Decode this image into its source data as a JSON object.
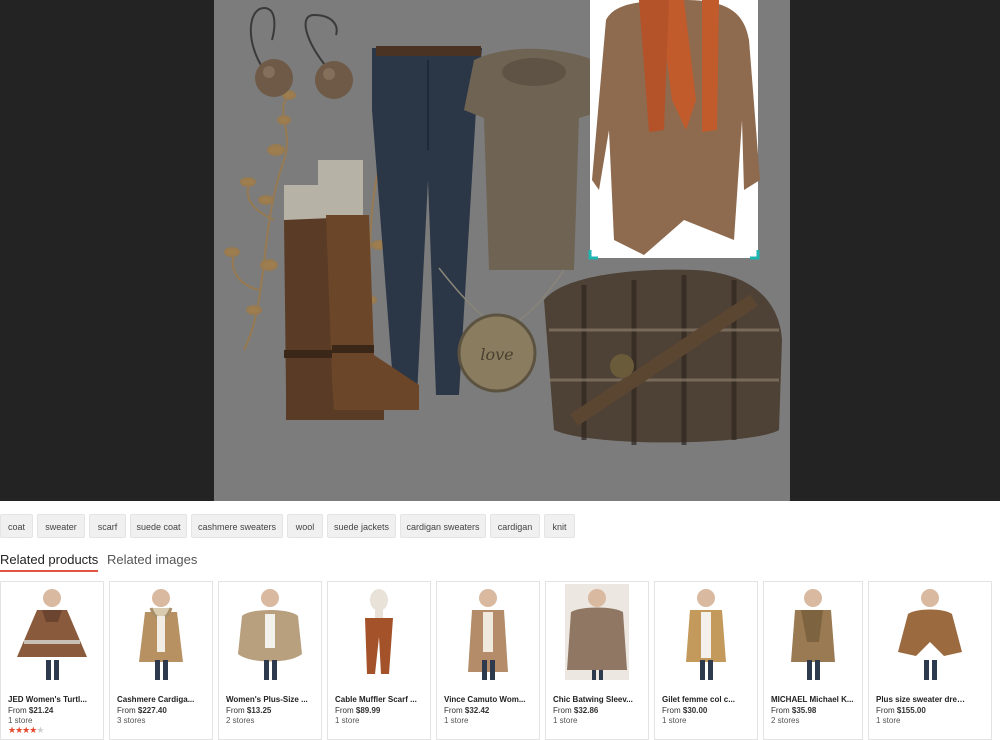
{
  "colors": {
    "viewer_bg": "#232323",
    "image_overlay": "#7c7c7c",
    "selection_bracket": "#1fb5b0",
    "active_tab_underline": "#e25440",
    "star": "#e64a2e"
  },
  "main_image": {
    "items": [
      "earrings",
      "boots",
      "jeans",
      "top",
      "cardigan-with-scarf",
      "necklace",
      "plaid-bag"
    ],
    "necklace_text": "love",
    "selected_item": "cardigan-with-scarf"
  },
  "tags": [
    "coat",
    "sweater",
    "scarf",
    "suede coat",
    "cashmere sweaters",
    "wool",
    "suede jackets",
    "cardigan sweaters",
    "cardigan",
    "knit"
  ],
  "tabs": [
    {
      "label": "Related products",
      "active": true
    },
    {
      "label": "Related images",
      "active": false
    }
  ],
  "products": [
    {
      "name": "JED Women's Turtl...",
      "price_prefix": "From ",
      "price": "$21.24",
      "stores": "1 store",
      "rating": 4,
      "garment": "poncho",
      "color": "#8a5a3c"
    },
    {
      "name": "Cashmere Cardiga...",
      "price_prefix": "From ",
      "price": "$227.40",
      "stores": "3 stores",
      "rating": null,
      "garment": "cardigan-fur",
      "color": "#b89163"
    },
    {
      "name": "Women's Plus-Size ...",
      "price_prefix": "From ",
      "price": "$13.25",
      "stores": "2 stores",
      "rating": null,
      "garment": "cocoon",
      "color": "#b8a07f"
    },
    {
      "name": "Cable Muffler Scarf ...",
      "price_prefix": "From ",
      "price": "$89.99",
      "stores": "1 store",
      "rating": null,
      "garment": "scarf",
      "color": "#a4522a"
    },
    {
      "name": "Vince Camuto Wom...",
      "price_prefix": "From ",
      "price": "$32.42",
      "stores": "1 store",
      "rating": null,
      "garment": "long-cardigan",
      "color": "#b58c6a"
    },
    {
      "name": "Chic Batwing Sleev...",
      "price_prefix": "From ",
      "price": "$32.86",
      "stores": "1 store",
      "rating": null,
      "garment": "batwing",
      "color": "#8f7763"
    },
    {
      "name": "Gilet femme col c...",
      "price_prefix": "From ",
      "price": "$30.00",
      "stores": "1 store",
      "rating": null,
      "garment": "open-cardigan",
      "color": "#c49a5c"
    },
    {
      "name": "MICHAEL Michael K...",
      "price_prefix": "From ",
      "price": "$35.98",
      "stores": "2 stores",
      "rating": null,
      "garment": "wrap-cardigan",
      "color": "#9a7a52"
    },
    {
      "name": "Plus size sweater dress Tu...",
      "price_prefix": "From ",
      "price": "$155.00",
      "stores": "1 store",
      "rating": null,
      "garment": "sweater-dress",
      "color": "#9b6a3f"
    }
  ]
}
